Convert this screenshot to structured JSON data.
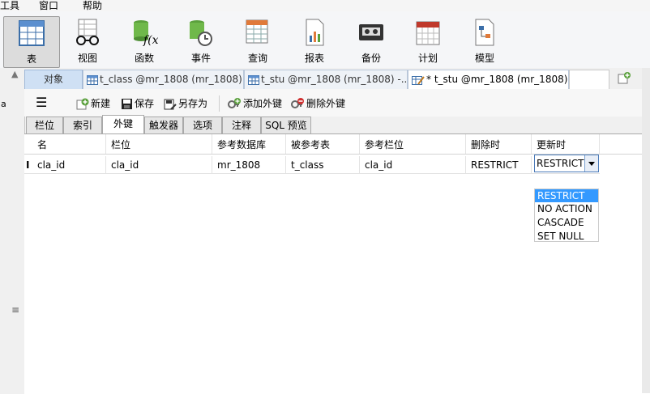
{
  "menubar": {
    "tools": "工具",
    "window": "窗口",
    "help": "帮助"
  },
  "ribbon": {
    "buttons": [
      {
        "label": "表",
        "icon": "table-icon"
      },
      {
        "label": "视图",
        "icon": "view-glasses-icon"
      },
      {
        "label": "函数",
        "icon": "function-icon"
      },
      {
        "label": "事件",
        "icon": "event-clock-icon"
      },
      {
        "label": "查询",
        "icon": "query-icon"
      },
      {
        "label": "报表",
        "icon": "report-icon"
      },
      {
        "label": "备份",
        "icon": "backup-tape-icon"
      },
      {
        "label": "计划",
        "icon": "calendar-icon"
      },
      {
        "label": "模型",
        "icon": "model-icon"
      }
    ]
  },
  "tabs": {
    "object": "对象",
    "items": [
      "t_class @mr_1808 (mr_1808)...",
      "t_stu @mr_1808 (mr_1808) -...",
      "* t_stu @mr_1808 (mr_1808)..."
    ]
  },
  "toolbar": {
    "new": "新建",
    "save": "保存",
    "save_as": "另存为",
    "add_fk": "添加外键",
    "delete_fk": "删除外键"
  },
  "subtabs": [
    "栏位",
    "索引",
    "外键",
    "触发器",
    "选项",
    "注释",
    "SQL 预览"
  ],
  "grid": {
    "headers": [
      "名",
      "栏位",
      "参考数据库",
      "被参考表",
      "参考栏位",
      "删除时",
      "更新时"
    ],
    "row": [
      "cla_id",
      "cla_id",
      "mr_1808",
      "t_class",
      "cla_id",
      "RESTRICT",
      "RESTRICT"
    ]
  },
  "dropdown": {
    "selected": "RESTRICT",
    "options": [
      "RESTRICT",
      "NO ACTION",
      "CASCADE",
      "SET NULL"
    ]
  },
  "gutter": {
    "mark_a": "a",
    "mark_lines": "≡",
    "row_cursor": "I"
  },
  "colors": {
    "selected": "#3399ff",
    "object_tab": "#cfe0f4"
  }
}
